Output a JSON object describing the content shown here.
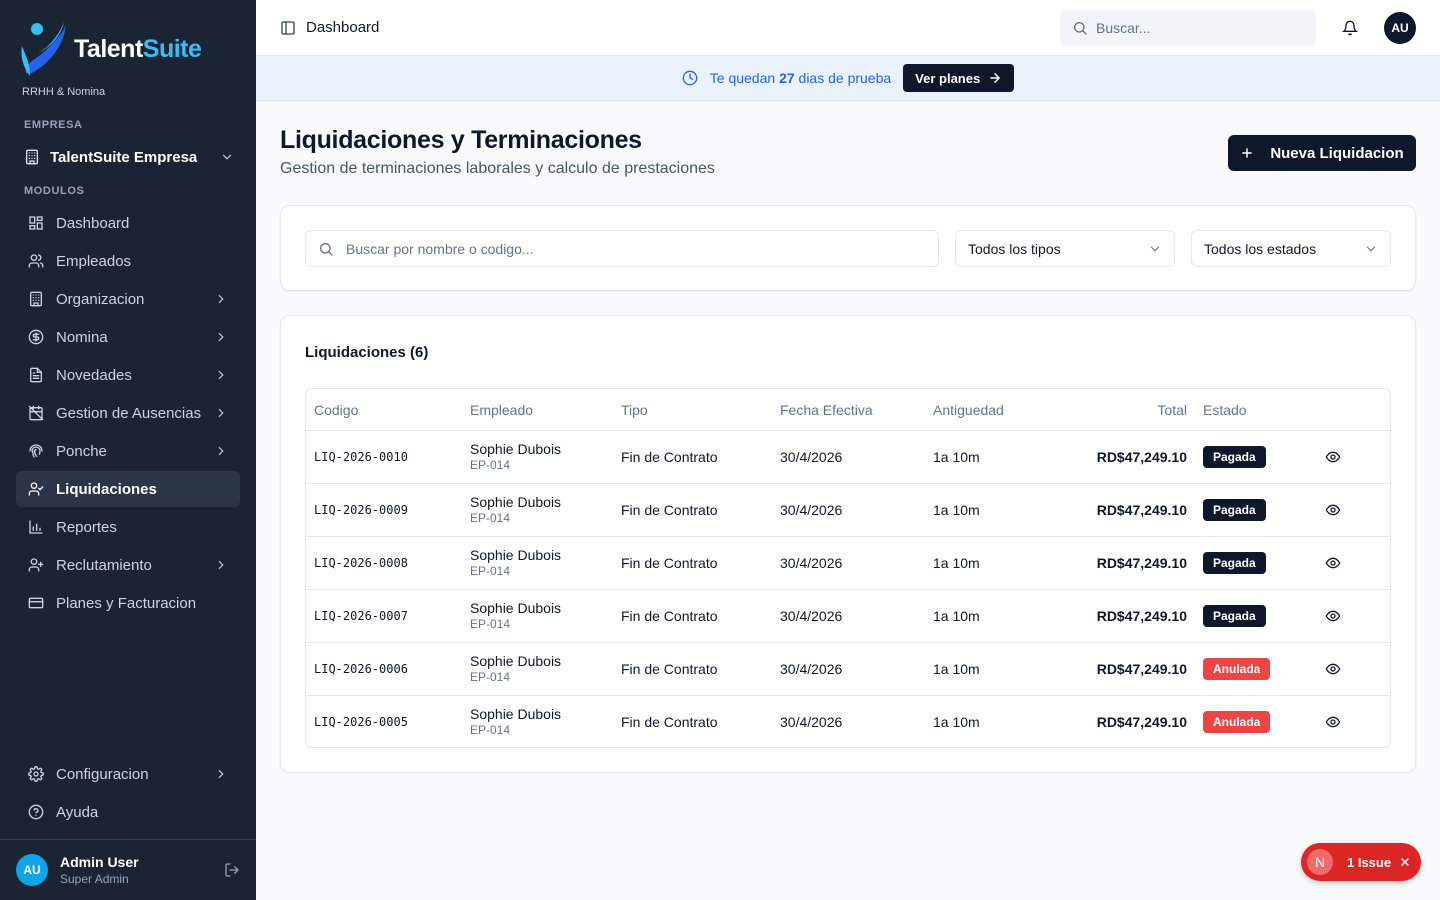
{
  "brand": {
    "name_part1": "Talent",
    "name_part2": "Suite",
    "subtitle": "RRHH & Nomina"
  },
  "sidebar": {
    "company_section_label": "EMPRESA",
    "company_name": "TalentSuite Empresa",
    "modules_section_label": "MODULOS",
    "items": [
      {
        "label": "Dashboard",
        "icon": "dashboard-icon",
        "has_chevron": false,
        "active": false
      },
      {
        "label": "Empleados",
        "icon": "users-icon",
        "has_chevron": false,
        "active": false
      },
      {
        "label": "Organizacion",
        "icon": "building-icon",
        "has_chevron": true,
        "active": false
      },
      {
        "label": "Nomina",
        "icon": "dollar-icon",
        "has_chevron": true,
        "active": false
      },
      {
        "label": "Novedades",
        "icon": "file-icon",
        "has_chevron": true,
        "active": false
      },
      {
        "label": "Gestion de Ausencias",
        "icon": "calendar-off-icon",
        "has_chevron": true,
        "active": false
      },
      {
        "label": "Ponche",
        "icon": "fingerprint-icon",
        "has_chevron": true,
        "active": false
      },
      {
        "label": "Liquidaciones",
        "icon": "user-minus-icon",
        "has_chevron": false,
        "active": true
      },
      {
        "label": "Reportes",
        "icon": "bar-chart-icon",
        "has_chevron": false,
        "active": false
      },
      {
        "label": "Reclutamiento",
        "icon": "user-plus-icon",
        "has_chevron": true,
        "active": false
      },
      {
        "label": "Planes y Facturacion",
        "icon": "credit-card-icon",
        "has_chevron": false,
        "active": false
      }
    ],
    "bottom_items": [
      {
        "label": "Configuracion",
        "icon": "gear-icon",
        "has_chevron": true
      },
      {
        "label": "Ayuda",
        "icon": "help-icon",
        "has_chevron": false
      }
    ],
    "user": {
      "initials": "AU",
      "name": "Admin User",
      "role": "Super Admin"
    }
  },
  "header": {
    "breadcrumb": "Dashboard",
    "search_placeholder": "Buscar...",
    "avatar_initials": "AU"
  },
  "trial_banner": {
    "text_before": "Te quedan",
    "days": "27",
    "text_after": "dias de prueba",
    "button_label": "Ver planes"
  },
  "page": {
    "title": "Liquidaciones y Terminaciones",
    "subtitle": "Gestion de terminaciones laborales y calculo de prestaciones",
    "new_button_label": "Nueva Liquidacion"
  },
  "filters": {
    "search_placeholder": "Buscar por nombre o codigo...",
    "type_select": "Todos los tipos",
    "state_select": "Todos los estados"
  },
  "table": {
    "title": "Liquidaciones (6)",
    "columns": [
      "Codigo",
      "Empleado",
      "Tipo",
      "Fecha Efectiva",
      "Antiguedad",
      "Total",
      "Estado"
    ],
    "rows": [
      {
        "code": "LIQ-2026-0010",
        "employee": "Sophie Dubois",
        "employee_id": "EP-014",
        "type": "Fin de Contrato",
        "date": "30/4/2026",
        "tenure": "1a 10m",
        "total": "RD$47,249.10",
        "state": "Pagada"
      },
      {
        "code": "LIQ-2026-0009",
        "employee": "Sophie Dubois",
        "employee_id": "EP-014",
        "type": "Fin de Contrato",
        "date": "30/4/2026",
        "tenure": "1a 10m",
        "total": "RD$47,249.10",
        "state": "Pagada"
      },
      {
        "code": "LIQ-2026-0008",
        "employee": "Sophie Dubois",
        "employee_id": "EP-014",
        "type": "Fin de Contrato",
        "date": "30/4/2026",
        "tenure": "1a 10m",
        "total": "RD$47,249.10",
        "state": "Pagada"
      },
      {
        "code": "LIQ-2026-0007",
        "employee": "Sophie Dubois",
        "employee_id": "EP-014",
        "type": "Fin de Contrato",
        "date": "30/4/2026",
        "tenure": "1a 10m",
        "total": "RD$47,249.10",
        "state": "Pagada"
      },
      {
        "code": "LIQ-2026-0006",
        "employee": "Sophie Dubois",
        "employee_id": "EP-014",
        "type": "Fin de Contrato",
        "date": "30/4/2026",
        "tenure": "1a 10m",
        "total": "RD$47,249.10",
        "state": "Anulada"
      },
      {
        "code": "LIQ-2026-0005",
        "employee": "Sophie Dubois",
        "employee_id": "EP-014",
        "type": "Fin de Contrato",
        "date": "30/4/2026",
        "tenure": "1a 10m",
        "total": "RD$47,249.10",
        "state": "Anulada"
      }
    ]
  },
  "issue_toast": {
    "badge": "N",
    "label": "1 Issue"
  },
  "colors": {
    "sidebar_bg": "#1b2433",
    "primary": "#0f172a",
    "accent_blue": "#2563eb",
    "brand_cyan": "#38bdf8",
    "badge_paid": "#0f172a",
    "badge_void": "#ef4444",
    "issue_red": "#dc2626"
  }
}
